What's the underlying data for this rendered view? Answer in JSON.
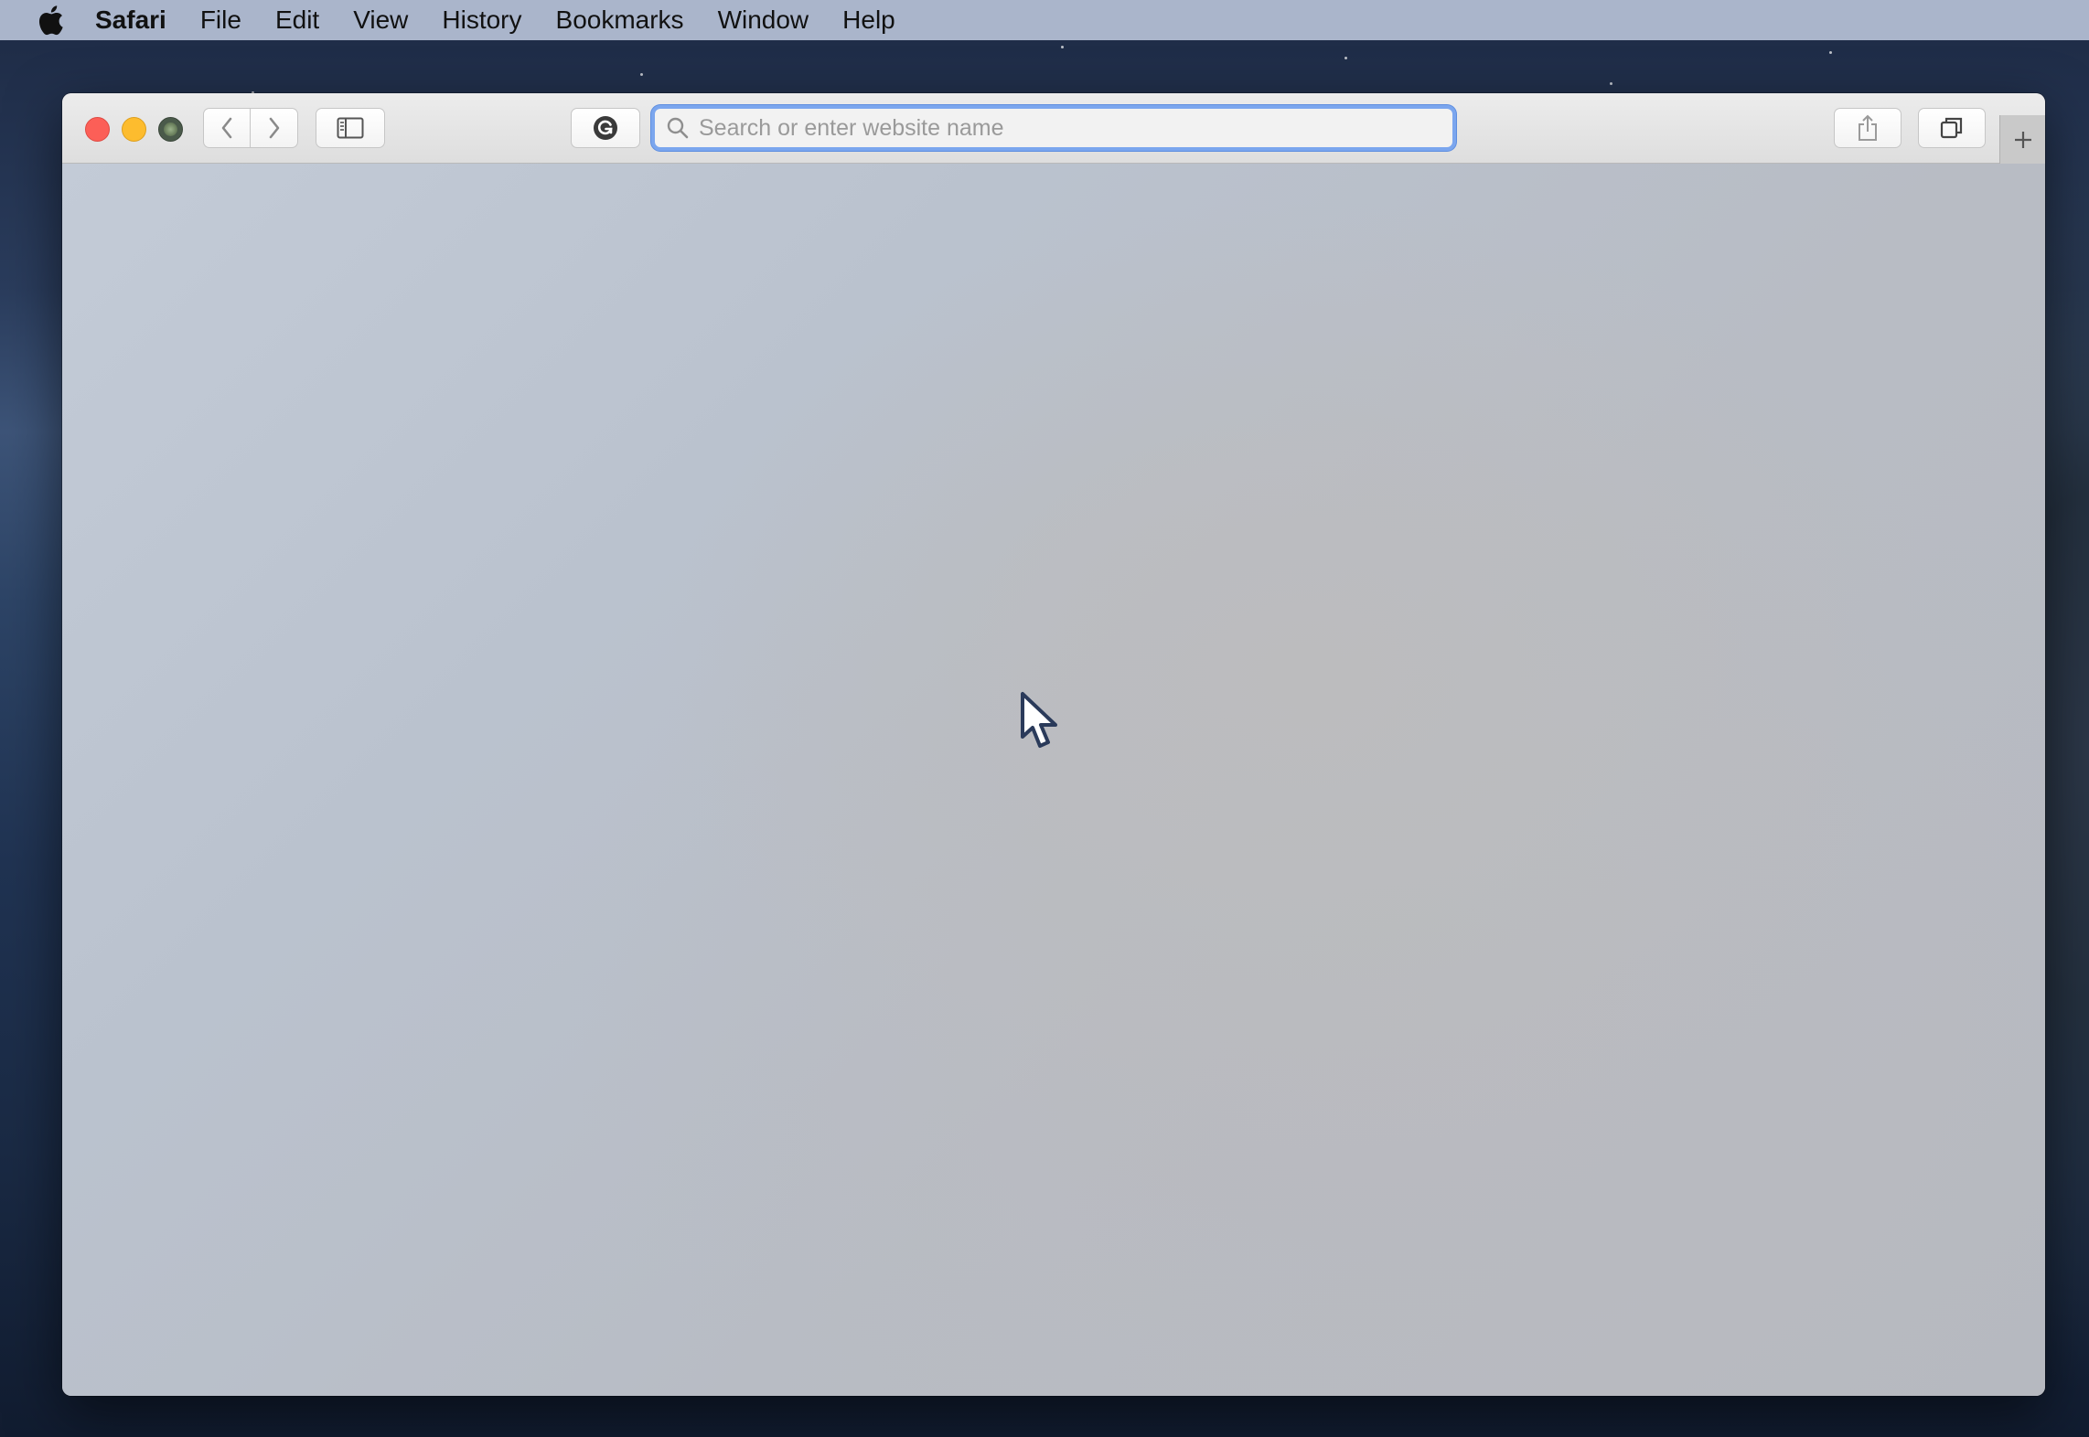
{
  "menubar": {
    "apple_icon": "apple-logo-icon",
    "app_name": "Safari",
    "items": [
      "File",
      "Edit",
      "View",
      "History",
      "Bookmarks",
      "Window",
      "Help"
    ]
  },
  "window": {
    "traffic_lights": {
      "close_color": "#fc5f57",
      "minimize_color": "#fdbc2e"
    },
    "toolbar": {
      "back_icon": "chevron-left-icon",
      "forward_icon": "chevron-right-icon",
      "sidebar_icon": "sidebar-icon",
      "grammarly_icon": "grammarly-icon",
      "share_icon": "share-icon",
      "tabs_icon": "tab-overview-icon",
      "new_tab_icon": "plus-icon"
    },
    "address_bar": {
      "value": "",
      "placeholder": "Search or enter website name",
      "focus_color": "#7ba6ee"
    }
  },
  "cursor": {
    "icon": "arrow-cursor-icon"
  }
}
